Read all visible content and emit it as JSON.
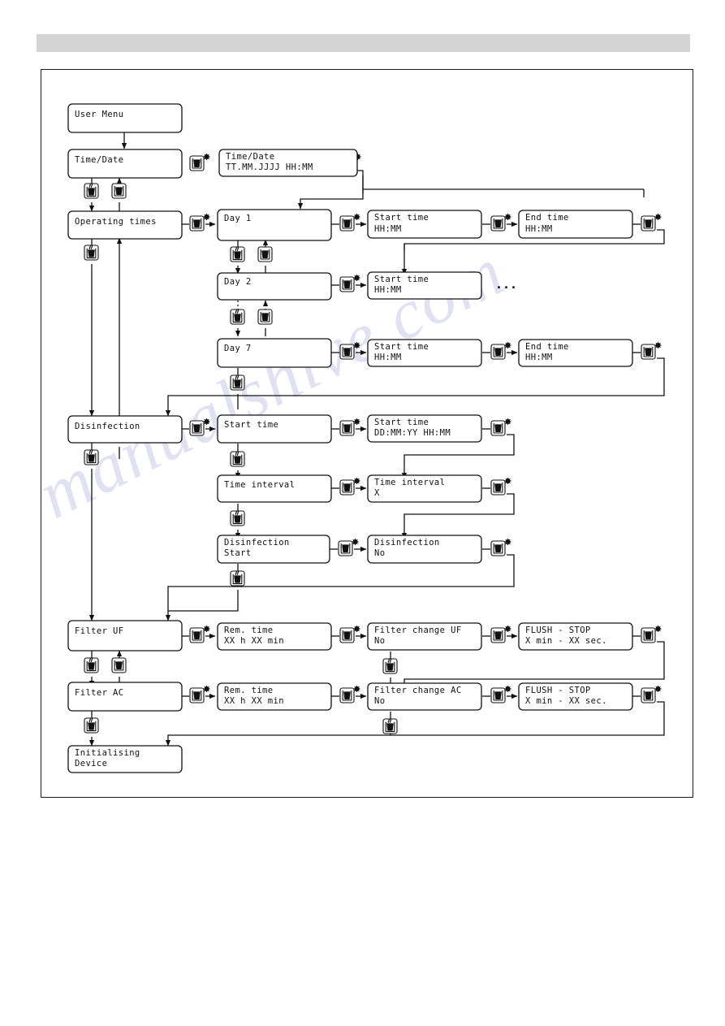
{
  "page": {
    "title": "User Menu navigation flow diagram",
    "watermark_text": "manualshive.com",
    "header_bar_color": "#d4d4d4",
    "frame_border_color": "#1a1a1a",
    "ellipsis": "..."
  },
  "icons": {
    "press_short": "glass-button-asterisk-icon",
    "press_down": "glass-button-down-arrow-icon",
    "press_plain": "glass-button-icon",
    "asterisk_glyph": "✻"
  },
  "nodes": {
    "user_menu": {
      "lines": [
        "User Menu"
      ]
    },
    "time_date": {
      "lines": [
        "Time/Date"
      ]
    },
    "time_date_val": {
      "lines": [
        "Time/Date",
        "TT.MM.JJJJ   HH:MM"
      ]
    },
    "operating_times": {
      "lines": [
        "Operating times"
      ]
    },
    "day1": {
      "lines": [
        "Day 1"
      ]
    },
    "day1_start": {
      "lines": [
        "Start time",
        "HH:MM"
      ]
    },
    "day1_end": {
      "lines": [
        "End time",
        "HH:MM"
      ]
    },
    "day2": {
      "lines": [
        "Day 2"
      ]
    },
    "day2_start": {
      "lines": [
        "Start time",
        "HH:MM"
      ]
    },
    "day7": {
      "lines": [
        "Day 7"
      ]
    },
    "day7_start": {
      "lines": [
        "Start time",
        "HH:MM"
      ]
    },
    "day7_end": {
      "lines": [
        "End time",
        "HH:MM"
      ]
    },
    "disinfection": {
      "lines": [
        "Disinfection"
      ]
    },
    "dis_start": {
      "lines": [
        "Start time"
      ]
    },
    "dis_start_val": {
      "lines": [
        "Start time",
        "DD:MM:YY    HH:MM"
      ]
    },
    "time_interval": {
      "lines": [
        "Time interval"
      ]
    },
    "time_interval_val": {
      "lines": [
        "Time interval",
        "  X"
      ]
    },
    "dis_start2": {
      "lines": [
        "Disinfection",
        "Start"
      ]
    },
    "dis_no": {
      "lines": [
        "Disinfection",
        "No"
      ]
    },
    "filter_uf": {
      "lines": [
        "Filter UF"
      ]
    },
    "rem_time_uf": {
      "lines": [
        "Rem. time",
        "XX h XX min"
      ]
    },
    "filter_change_uf": {
      "lines": [
        "Filter change UF",
        "No"
      ]
    },
    "flush_stop_uf": {
      "lines": [
        "FLUSH - STOP",
        " X min - XX sec."
      ]
    },
    "filter_ac": {
      "lines": [
        "Filter AC"
      ]
    },
    "rem_time_ac": {
      "lines": [
        "Rem. time",
        "XX h XX min"
      ]
    },
    "filter_change_ac": {
      "lines": [
        "Filter change AC",
        "No"
      ]
    },
    "flush_stop_ac": {
      "lines": [
        "FLUSH - STOP",
        " X min - XX sec."
      ]
    },
    "initialising": {
      "lines": [
        "Initialising",
        "Device"
      ]
    }
  }
}
